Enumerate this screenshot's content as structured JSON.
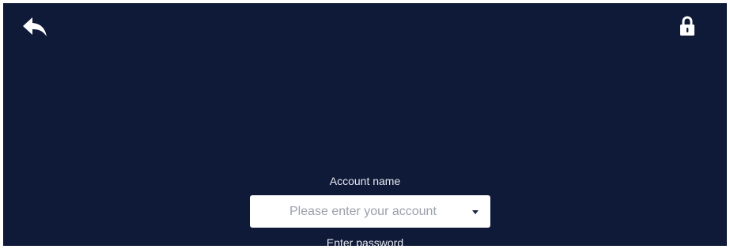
{
  "icons": {
    "back": "back-arrow-icon",
    "lock": "lock-icon",
    "dropdown": "chevron-down-icon"
  },
  "colors": {
    "background": "#0f1a38",
    "label_text": "#e6e9f0",
    "field_background": "#ffffff",
    "placeholder_text": "#9aa0aa"
  },
  "login_form": {
    "account_label": "Account name",
    "account_placeholder": "Please enter your account",
    "password_label": "Enter password"
  }
}
